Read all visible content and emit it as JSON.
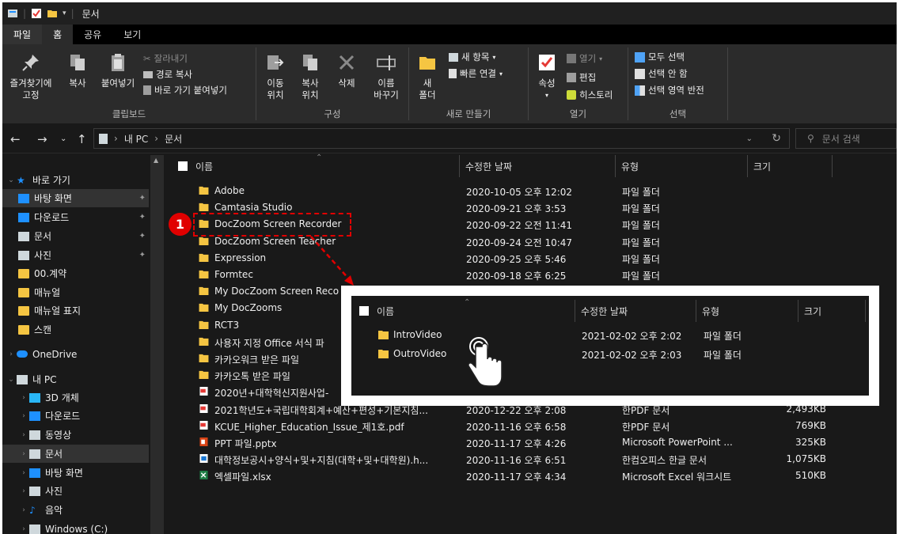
{
  "window": {
    "title": "문서"
  },
  "menu_tabs": {
    "file": "파일",
    "home": "홈",
    "share": "공유",
    "view": "보기"
  },
  "ribbon": {
    "clipboard": {
      "group": "클립보드",
      "pin": "즐겨찾기에\n고정",
      "copy": "복사",
      "paste": "붙여넣기",
      "cut": "잘라내기",
      "copy_path": "경로 복사",
      "paste_shortcut": "바로 가기 붙여넣기"
    },
    "organize": {
      "group": "구성",
      "move_to": "이동\n위치",
      "copy_to": "복사\n위치",
      "delete": "삭제",
      "rename": "이름\n바꾸기"
    },
    "new": {
      "group": "새로 만들기",
      "new_folder": "새\n폴더",
      "new_item": "새 항목",
      "easy_access": "빠른 연결"
    },
    "open": {
      "group": "열기",
      "properties": "속성",
      "open": "열기",
      "edit": "편집",
      "history": "히스토리"
    },
    "select": {
      "group": "선택",
      "select_all": "모두 선택",
      "select_none": "선택 안 함",
      "invert": "선택 영역 반전"
    }
  },
  "address": {
    "crumbs": [
      "내 PC",
      "문서"
    ],
    "search_placeholder": "문서 검색"
  },
  "sidebar": {
    "items": [
      {
        "label": "바로 가기",
        "icon": "star-icon",
        "color": "#1e90ff"
      },
      {
        "label": "바탕 화면",
        "icon": "desktop-icon",
        "color": "#1e90ff"
      },
      {
        "label": "다운로드",
        "icon": "download-icon",
        "color": "#1e90ff"
      },
      {
        "label": "문서",
        "icon": "document-icon",
        "color": "#cfd8dc"
      },
      {
        "label": "사진",
        "icon": "picture-icon",
        "color": "#cfd8dc"
      },
      {
        "label": "00.계약",
        "icon": "folder-icon",
        "color": "#f5c542"
      },
      {
        "label": "매뉴얼",
        "icon": "folder-icon",
        "color": "#f5c542"
      },
      {
        "label": "매뉴얼 표지",
        "icon": "folder-icon",
        "color": "#f5c542"
      },
      {
        "label": "스캔",
        "icon": "folder-icon",
        "color": "#f5c542"
      },
      {
        "label": "OneDrive",
        "icon": "cloud-icon",
        "color": "#1e90ff"
      },
      {
        "label": "내 PC",
        "icon": "computer-icon",
        "color": "#cfd8dc"
      },
      {
        "label": "3D 개체",
        "icon": "cube-icon",
        "color": "#29b6f6"
      },
      {
        "label": "다운로드",
        "icon": "download-icon",
        "color": "#1e90ff"
      },
      {
        "label": "동영상",
        "icon": "video-icon",
        "color": "#cfd8dc"
      },
      {
        "label": "문서",
        "icon": "document-icon",
        "color": "#cfd8dc"
      },
      {
        "label": "바탕 화면",
        "icon": "desktop-icon",
        "color": "#1e90ff"
      },
      {
        "label": "사진",
        "icon": "picture-icon",
        "color": "#cfd8dc"
      },
      {
        "label": "음악",
        "icon": "music-icon",
        "color": "#1e90ff"
      },
      {
        "label": "Windows (C:)",
        "icon": "drive-icon",
        "color": "#cfd8dc"
      }
    ]
  },
  "columns": {
    "name": "이름",
    "date": "수정한 날짜",
    "type": "유형",
    "size": "크기"
  },
  "files": [
    {
      "name": "Adobe",
      "date": "2020-10-05 오후 12:02",
      "type": "파일 폴더",
      "size": "",
      "icon": "folder-icon"
    },
    {
      "name": "Camtasia Studio",
      "date": "2020-09-21 오후 3:53",
      "type": "파일 폴더",
      "size": "",
      "icon": "folder-icon"
    },
    {
      "name": "DocZoom Screen Recorder",
      "date": "2020-09-22 오전 11:41",
      "type": "파일 폴더",
      "size": "",
      "icon": "folder-icon"
    },
    {
      "name": "DocZoom Screen Teacher",
      "date": "2020-09-24 오전 10:47",
      "type": "파일 폴더",
      "size": "",
      "icon": "folder-icon"
    },
    {
      "name": "Expression",
      "date": "2020-09-25 오후 5:46",
      "type": "파일 폴더",
      "size": "",
      "icon": "folder-icon"
    },
    {
      "name": "Formtec",
      "date": "2020-09-18 오후 6:25",
      "type": "파일 폴더",
      "size": "",
      "icon": "folder-icon"
    },
    {
      "name": "My DocZoom Screen Reco",
      "date": "",
      "type": "",
      "size": "",
      "icon": "folder-icon"
    },
    {
      "name": "My DocZooms",
      "date": "",
      "type": "",
      "size": "",
      "icon": "folder-icon"
    },
    {
      "name": "RCT3",
      "date": "",
      "type": "",
      "size": "",
      "icon": "folder-icon"
    },
    {
      "name": "사용자 지정 Office 서식 파",
      "date": "",
      "type": "",
      "size": "",
      "icon": "folder-icon"
    },
    {
      "name": "카카오워크 받은 파일",
      "date": "",
      "type": "",
      "size": "",
      "icon": "folder-icon"
    },
    {
      "name": "카카오톡 받은 파일",
      "date": "",
      "type": "",
      "size": "",
      "icon": "folder-icon"
    },
    {
      "name": "2020년+대학혁신지원사업-",
      "date": "",
      "type": "",
      "size": "",
      "icon": "pdf-icon"
    },
    {
      "name": "2021학년도+국립대학회계+예산+편성+기본지침...",
      "date": "2020-12-22 오후 2:08",
      "type": "한PDF 문서",
      "size": "2,493KB",
      "icon": "pdf-icon"
    },
    {
      "name": "KCUE_Higher_Education_Issue_제1호.pdf",
      "date": "2020-11-16 오후 6:58",
      "type": "한PDF 문서",
      "size": "769KB",
      "icon": "pdf-icon"
    },
    {
      "name": "PPT 파일.pptx",
      "date": "2020-11-17 오후 4:26",
      "type": "Microsoft PowerPoint ...",
      "size": "325KB",
      "icon": "ppt-icon"
    },
    {
      "name": "대학정보공시+양식+및+지침(대학+및+대학원).h...",
      "date": "2020-11-16 오후 6:51",
      "type": "한컴오피스 한글 문서",
      "size": "1,075KB",
      "icon": "hwp-icon"
    },
    {
      "name": "엑셀파일.xlsx",
      "date": "2020-11-17 오후 4:34",
      "type": "Microsoft Excel 워크시트",
      "size": "510KB",
      "icon": "excel-icon"
    }
  ],
  "callout": {
    "badge": "1"
  },
  "zoom_panel": {
    "columns": {
      "name": "이름",
      "date": "수정한 날짜",
      "type": "유형",
      "size": "크기"
    },
    "files": [
      {
        "name": "IntroVideo",
        "date": "2021-02-02 오후 2:02",
        "type": "파일 폴더"
      },
      {
        "name": "OutroVideo",
        "date": "2021-02-02 오후 2:03",
        "type": "파일 폴더"
      }
    ]
  }
}
